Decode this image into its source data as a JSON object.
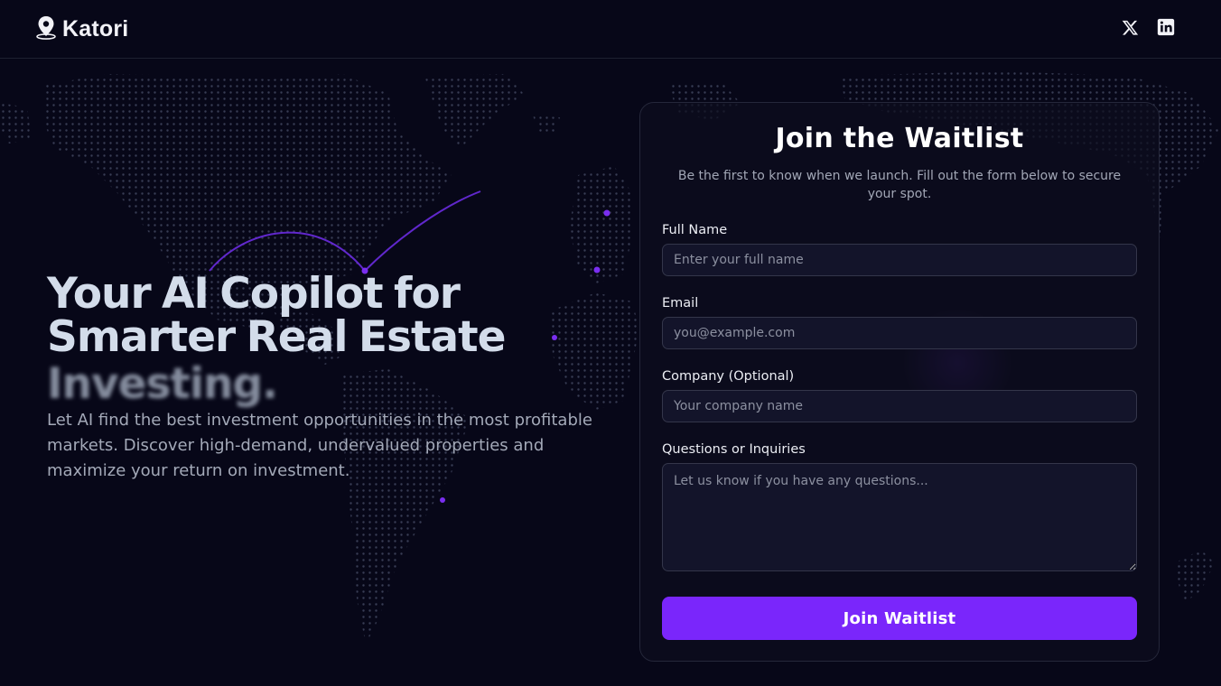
{
  "brand": {
    "name": "Katori",
    "icon": "map-pin-icon"
  },
  "social": [
    {
      "name": "x-twitter-icon"
    },
    {
      "name": "linkedin-icon"
    }
  ],
  "hero": {
    "title_line1": "Your AI Copilot for",
    "title_line2": "Smarter Real Estate",
    "title_line3": "Investing.",
    "description": "Let AI find the best investment opportunities in the most profitable markets. Discover high-demand, undervalued properties and maximize your return on investment."
  },
  "form": {
    "title": "Join the Waitlist",
    "subtitle": "Be the first to know when we launch. Fill out the form below to secure your spot.",
    "fields": {
      "full_name": {
        "label": "Full Name",
        "placeholder": "Enter your full name",
        "value": ""
      },
      "email": {
        "label": "Email",
        "placeholder": "you@example.com",
        "value": ""
      },
      "company": {
        "label": "Company (Optional)",
        "placeholder": "Your company name",
        "value": ""
      },
      "questions": {
        "label": "Questions or Inquiries",
        "placeholder": "Let us know if you have any questions...",
        "value": ""
      }
    },
    "submit_label": "Join Waitlist"
  },
  "colors": {
    "background": "#070718",
    "accent": "#7a26fb",
    "map_dot": "#3a3f58",
    "arc": "#6a2be0"
  }
}
